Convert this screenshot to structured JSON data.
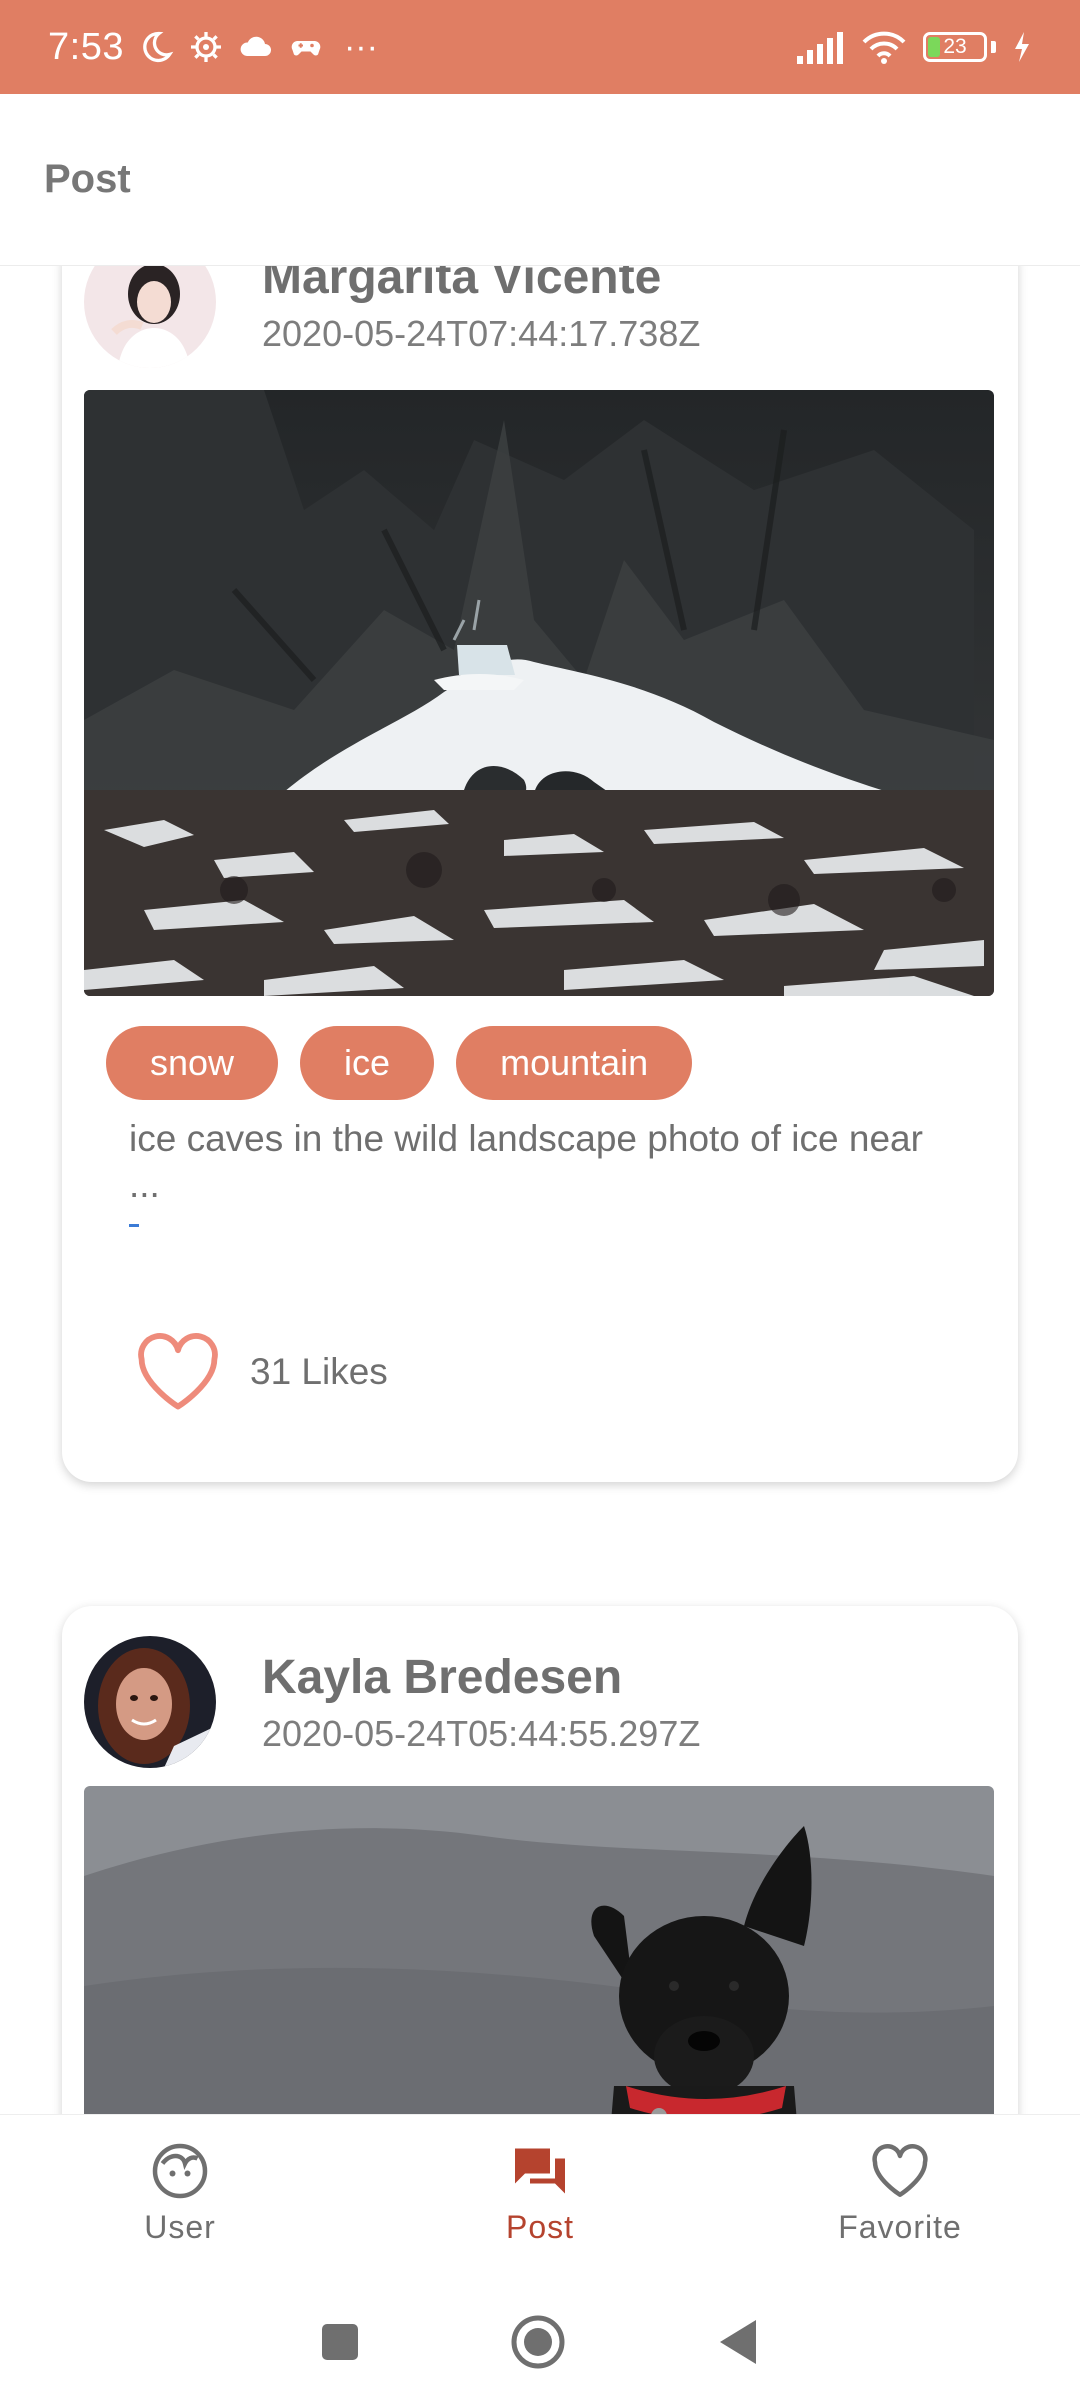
{
  "status_bar": {
    "time": "7:53",
    "battery": "23",
    "icons": [
      "moon-icon",
      "settings-icon",
      "cloud-icon",
      "gamepad-icon",
      "more-dots-icon",
      "signal-icon",
      "wifi-icon",
      "battery-icon",
      "charging-icon"
    ],
    "more": "···"
  },
  "app_bar": {
    "title": "Post"
  },
  "posts": [
    {
      "user_name": "Margarita Vicente",
      "date": "2020-05-24T07:44:17.738Z",
      "tags": [
        "snow",
        "ice",
        "mountain"
      ],
      "description": "ice caves in the wild landscape photo of ice near ...",
      "link": "-",
      "likes": "31 Likes"
    },
    {
      "user_name": "Kayla Bredesen",
      "date": "2020-05-24T05:44:55.297Z"
    }
  ],
  "bottom_nav": [
    {
      "label": "User",
      "icon": "user-face-icon"
    },
    {
      "label": "Post",
      "icon": "chat-bubbles-icon",
      "active": true
    },
    {
      "label": "Favorite",
      "icon": "heart-icon"
    }
  ],
  "colors": {
    "accent": "#E07E63",
    "active_nav": "#B5432E",
    "heart": "#EE8B7B"
  }
}
